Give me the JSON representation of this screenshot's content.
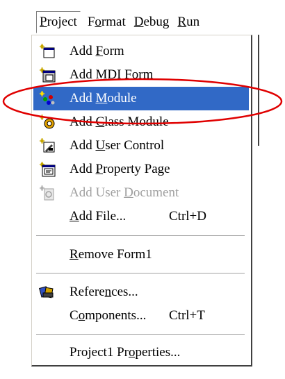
{
  "menubar": {
    "items": [
      {
        "pre": "",
        "key": "P",
        "post": "roject"
      },
      {
        "pre": "F",
        "key": "o",
        "post": "rmat"
      },
      {
        "pre": "",
        "key": "D",
        "post": "ebug"
      },
      {
        "pre": "",
        "key": "R",
        "post": "un"
      }
    ]
  },
  "menu": {
    "items": [
      {
        "pre": "Add ",
        "key": "F",
        "post": "orm",
        "shortcut": "",
        "icon": "add-form-icon"
      },
      {
        "pre": "Add MD",
        "key": "I",
        "post": " Form",
        "shortcut": "",
        "icon": "add-mdi-form-icon"
      },
      {
        "pre": "Add ",
        "key": "M",
        "post": "odule",
        "shortcut": "",
        "icon": "add-module-icon",
        "selected": true
      },
      {
        "pre": "Add ",
        "key": "C",
        "post": "lass Module",
        "shortcut": "",
        "icon": "add-class-module-icon"
      },
      {
        "pre": "Add ",
        "key": "U",
        "post": "ser Control",
        "shortcut": "",
        "icon": "add-user-control-icon"
      },
      {
        "pre": "Add ",
        "key": "P",
        "post": "roperty Page",
        "shortcut": "",
        "icon": "add-property-page-icon"
      },
      {
        "pre": "Add User ",
        "key": "D",
        "post": "ocument",
        "shortcut": "",
        "icon": "add-user-document-icon",
        "disabled": true
      },
      {
        "pre": "",
        "key": "A",
        "post": "dd File...",
        "shortcut": "Ctrl+D",
        "icon": ""
      },
      {
        "pre": "",
        "key": "R",
        "post": "emove Form1",
        "shortcut": "",
        "icon": ""
      },
      {
        "pre": "Refere",
        "key": "n",
        "post": "ces...",
        "shortcut": "",
        "icon": "references-icon"
      },
      {
        "pre": "C",
        "key": "o",
        "post": "mponents...",
        "shortcut": "Ctrl+T",
        "icon": ""
      },
      {
        "pre": "Project1 Pr",
        "key": "o",
        "post": "perties...",
        "shortcut": "",
        "icon": ""
      }
    ]
  },
  "colors": {
    "selection": "#3169c6",
    "highlight_ellipse": "#e00000",
    "disabled_text": "#a0a0a0"
  }
}
